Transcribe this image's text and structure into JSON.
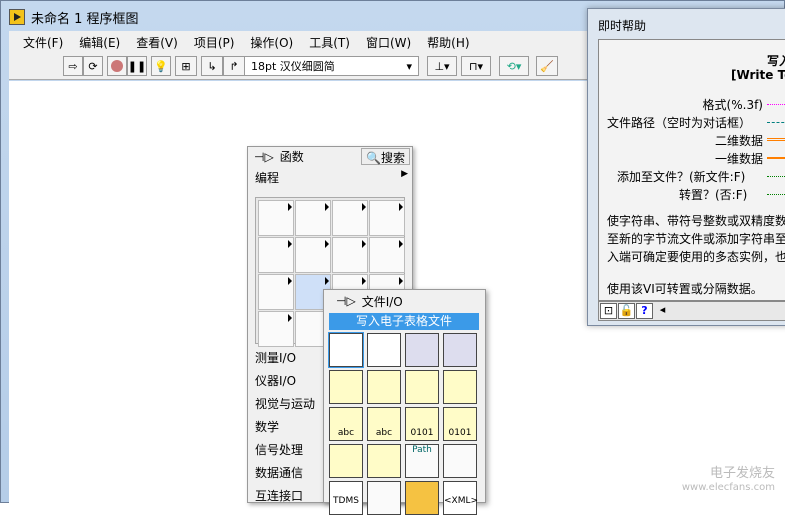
{
  "window": {
    "title": "未命名 1 程序框图"
  },
  "menu": [
    "文件(F)",
    "编辑(E)",
    "查看(V)",
    "项目(P)",
    "操作(O)",
    "工具(T)",
    "窗口(W)",
    "帮助(H)"
  ],
  "toolbar": {
    "font": "18pt 汉仪细圆简"
  },
  "help": {
    "title": "即时帮助",
    "vi_name": "写入",
    "vi_name_en": "[Write To",
    "terminals": [
      "格式(%.3f)",
      "文件路径（空时为对话框）",
      "二维数据",
      "一维数据",
      "添加至文件？(新文件:F)",
      "转置？(否:F)"
    ],
    "description": [
      "使字符串、带符号整数或双精度数",
      "至新的字节流文件或添加字符串至",
      "入端可确定要使用的多态实例，也"
    ],
    "note": "使用该VI可转置或分隔数据。",
    "colors": {
      "format": "#ff00ff",
      "path": "#007f7f",
      "array": "#ff7f00",
      "bool": "#008000"
    }
  },
  "palette": {
    "title": "函数",
    "search": "搜索",
    "category": "编程",
    "categories": [
      "测量I/O",
      "仪器I/O",
      "视觉与运动",
      "数学",
      "信号处理",
      "数据通信",
      "互连接口"
    ]
  },
  "file_io": {
    "title": "文件I/O",
    "selected": "写入电子表格文件",
    "icon_labels": [
      "abc",
      "abc",
      "0101",
      "0101",
      "Path",
      "TDMS",
      "<XML>"
    ]
  },
  "watermark": {
    "line1": "电子发烧友",
    "line2": "www.elecfans.com"
  }
}
